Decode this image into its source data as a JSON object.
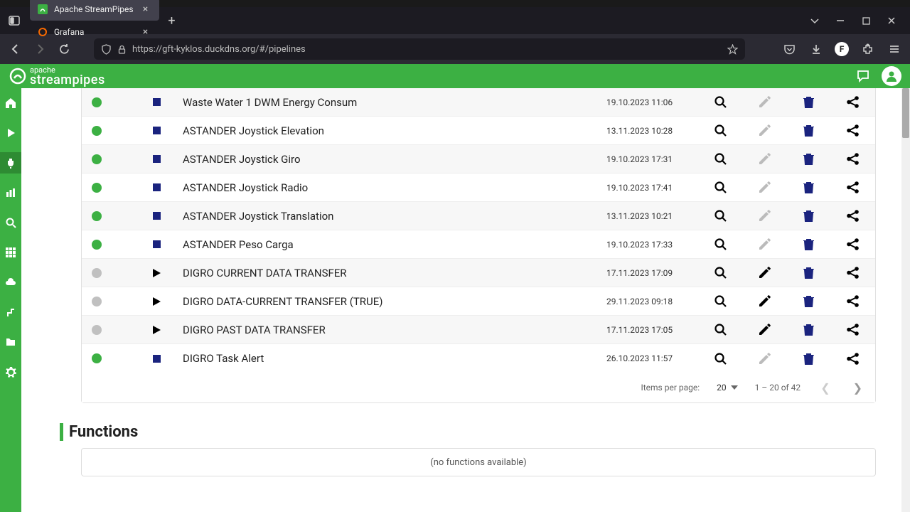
{
  "browser": {
    "tabs": [
      {
        "title": "Apache StreamPipes",
        "active": true
      },
      {
        "title": "Grafana",
        "active": false
      }
    ],
    "url": "https://gft-kyklos.duckdns.org/#/pipelines"
  },
  "header": {
    "logo_top": "apache",
    "logo_bottom": "streampipes"
  },
  "pipelines": [
    {
      "status": "running",
      "control": "stop",
      "name": "Waste Water 1 DWM Energy Consum",
      "date": "19.10.2023 11:06",
      "editDisabled": true
    },
    {
      "status": "running",
      "control": "stop",
      "name": "ASTANDER Joystick Elevation",
      "date": "13.11.2023 10:28",
      "editDisabled": true
    },
    {
      "status": "running",
      "control": "stop",
      "name": "ASTANDER Joystick Giro",
      "date": "19.10.2023 17:31",
      "editDisabled": true
    },
    {
      "status": "running",
      "control": "stop",
      "name": "ASTANDER Joystick Radio",
      "date": "19.10.2023 17:41",
      "editDisabled": true
    },
    {
      "status": "running",
      "control": "stop",
      "name": "ASTANDER Joystick Translation",
      "date": "13.11.2023 10:21",
      "editDisabled": true
    },
    {
      "status": "running",
      "control": "stop",
      "name": "ASTANDER Peso Carga",
      "date": "19.10.2023 17:33",
      "editDisabled": true
    },
    {
      "status": "stopped",
      "control": "play",
      "name": "DIGRO CURRENT DATA TRANSFER",
      "date": "17.11.2023 17:09",
      "editDisabled": false
    },
    {
      "status": "stopped",
      "control": "play",
      "name": "DIGRO DATA-CURRENT TRANSFER (TRUE)",
      "date": "29.11.2023 09:18",
      "editDisabled": false
    },
    {
      "status": "stopped",
      "control": "play",
      "name": "DIGRO PAST DATA TRANSFER",
      "date": "17.11.2023 17:05",
      "editDisabled": false
    },
    {
      "status": "running",
      "control": "stop",
      "name": "DIGRO Task Alert",
      "date": "26.10.2023 11:57",
      "editDisabled": true
    }
  ],
  "paginator": {
    "label": "Items per page:",
    "pageSize": "20",
    "range": "1 – 20 of 42"
  },
  "functions": {
    "title": "Functions",
    "empty": "(no functions available)"
  }
}
